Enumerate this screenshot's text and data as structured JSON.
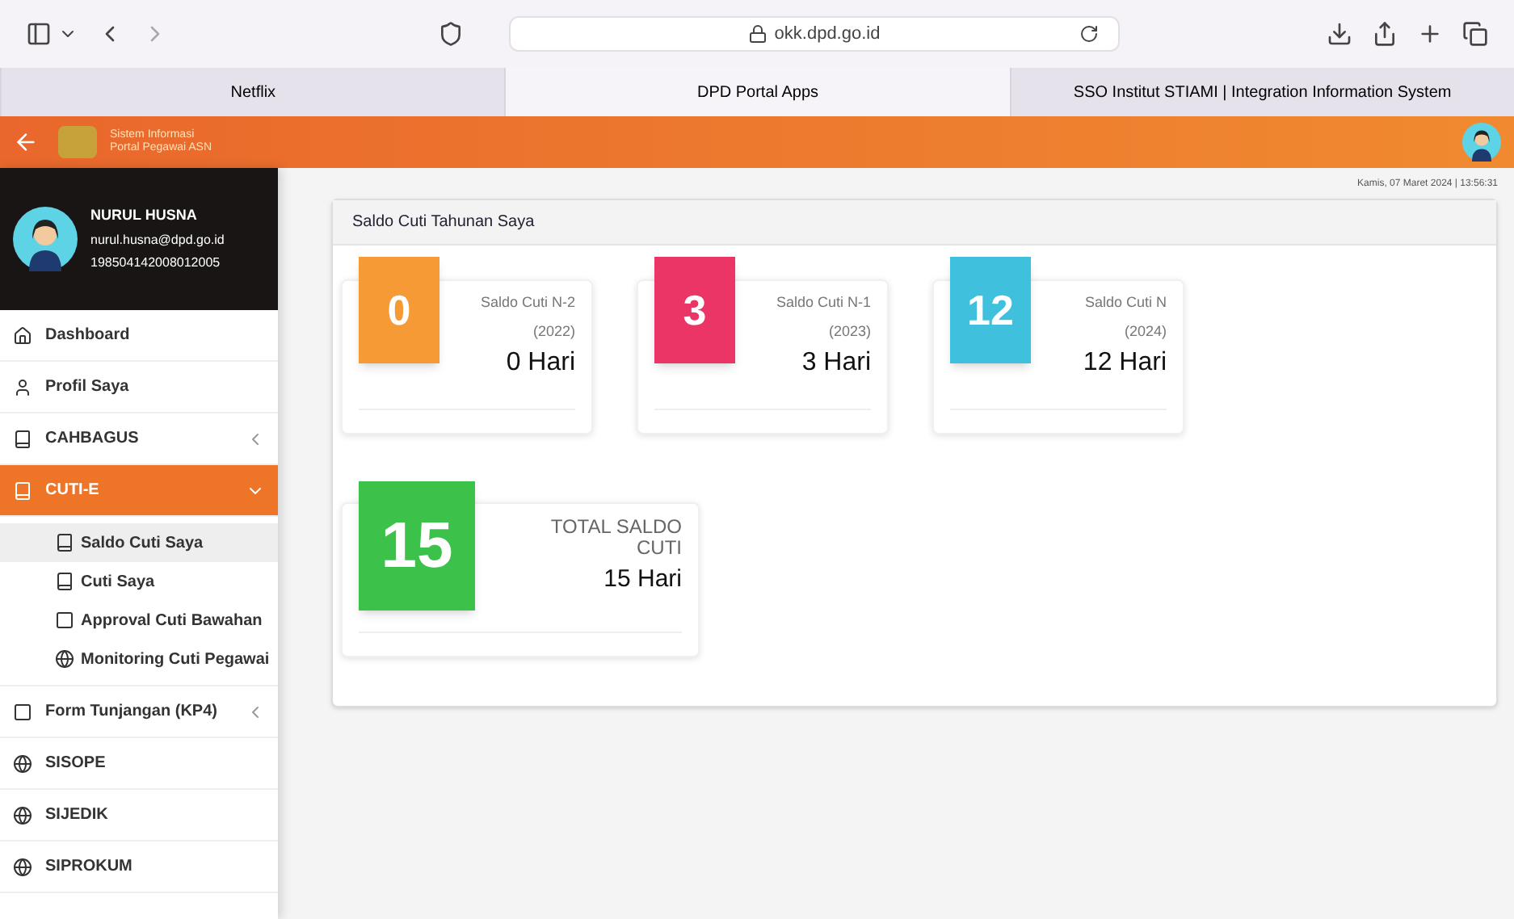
{
  "browser": {
    "address": "okk.dpd.go.id",
    "tabs": [
      {
        "label": "Netflix",
        "selected": false
      },
      {
        "label": "DPD Portal Apps",
        "selected": true
      },
      {
        "label": "SSO Institut STIAMI | Integration Information System",
        "selected": false
      }
    ]
  },
  "header": {
    "app_title": "Sistem Informasi",
    "app_subtitle": "Portal Pegawai ASN"
  },
  "profile": {
    "name": "NURUL HUSNA",
    "email": "nurul.husna@dpd.go.id",
    "nip": "198504142008012005"
  },
  "sidebar": {
    "items": [
      {
        "label": "Dashboard",
        "kind": "home",
        "selected": false
      },
      {
        "label": "Profil Saya",
        "kind": "user",
        "selected": false
      },
      {
        "label": "CAHBAGUS",
        "kind": "book",
        "selected": false,
        "expanded": false
      },
      {
        "label": "CUTI-E",
        "kind": "book",
        "selected": true,
        "expanded": true,
        "children": [
          {
            "label": "Saldo Cuti Saya",
            "kind": "book",
            "selected": true
          },
          {
            "label": "Cuti Saya",
            "kind": "book",
            "selected": false
          },
          {
            "label": "Approval Cuti Bawahan",
            "kind": "square",
            "selected": false
          },
          {
            "label": "Monitoring Cuti Pegawai",
            "kind": "globe",
            "selected": false
          }
        ]
      },
      {
        "label": "Form Tunjangan (KP4)",
        "kind": "square",
        "selected": false,
        "expanded": false
      },
      {
        "label": "SISOPE",
        "kind": "globe",
        "selected": false
      },
      {
        "label": "SIJEDIK",
        "kind": "globe",
        "selected": false
      },
      {
        "label": "SIPROKUM",
        "kind": "globe",
        "selected": false
      }
    ]
  },
  "datetime": "Kamis, 07 Maret 2024 | 13:56:31",
  "panel": {
    "title": "Saldo Cuti Tahunan Saya",
    "cards": [
      {
        "number": "0",
        "label": "Saldo Cuti N-2",
        "year": "(2022)",
        "value": "0 Hari",
        "color": "#f59a35"
      },
      {
        "number": "3",
        "label": "Saldo Cuti N-1",
        "year": "(2023)",
        "value": "3 Hari",
        "color": "#ea3566"
      },
      {
        "number": "12",
        "label": "Saldo Cuti N",
        "year": "(2024)",
        "value": "12 Hari",
        "color": "#3fc0dc"
      }
    ],
    "total": {
      "number": "15",
      "label": "TOTAL SALDO CUTI",
      "value": "15 Hari",
      "color": "#3cc24a"
    }
  }
}
